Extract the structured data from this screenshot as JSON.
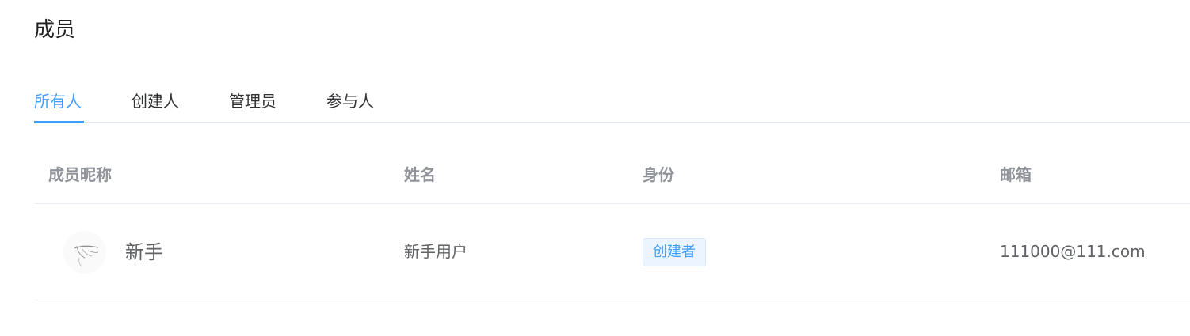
{
  "page": {
    "title": "成员"
  },
  "tabs": [
    {
      "label": "所有人",
      "active": true
    },
    {
      "label": "创建人",
      "active": false
    },
    {
      "label": "管理员",
      "active": false
    },
    {
      "label": "参与人",
      "active": false
    }
  ],
  "table": {
    "columns": [
      "成员昵称",
      "姓名",
      "身份",
      "邮箱"
    ],
    "rows": [
      {
        "avatar": "user-avatar",
        "nickname": "新手",
        "name": "新手用户",
        "role": "创建者",
        "email": "111000@111.com"
      }
    ]
  },
  "colors": {
    "accent": "#409eff",
    "tag_background": "#ecf5ff",
    "header_text": "#909399"
  }
}
